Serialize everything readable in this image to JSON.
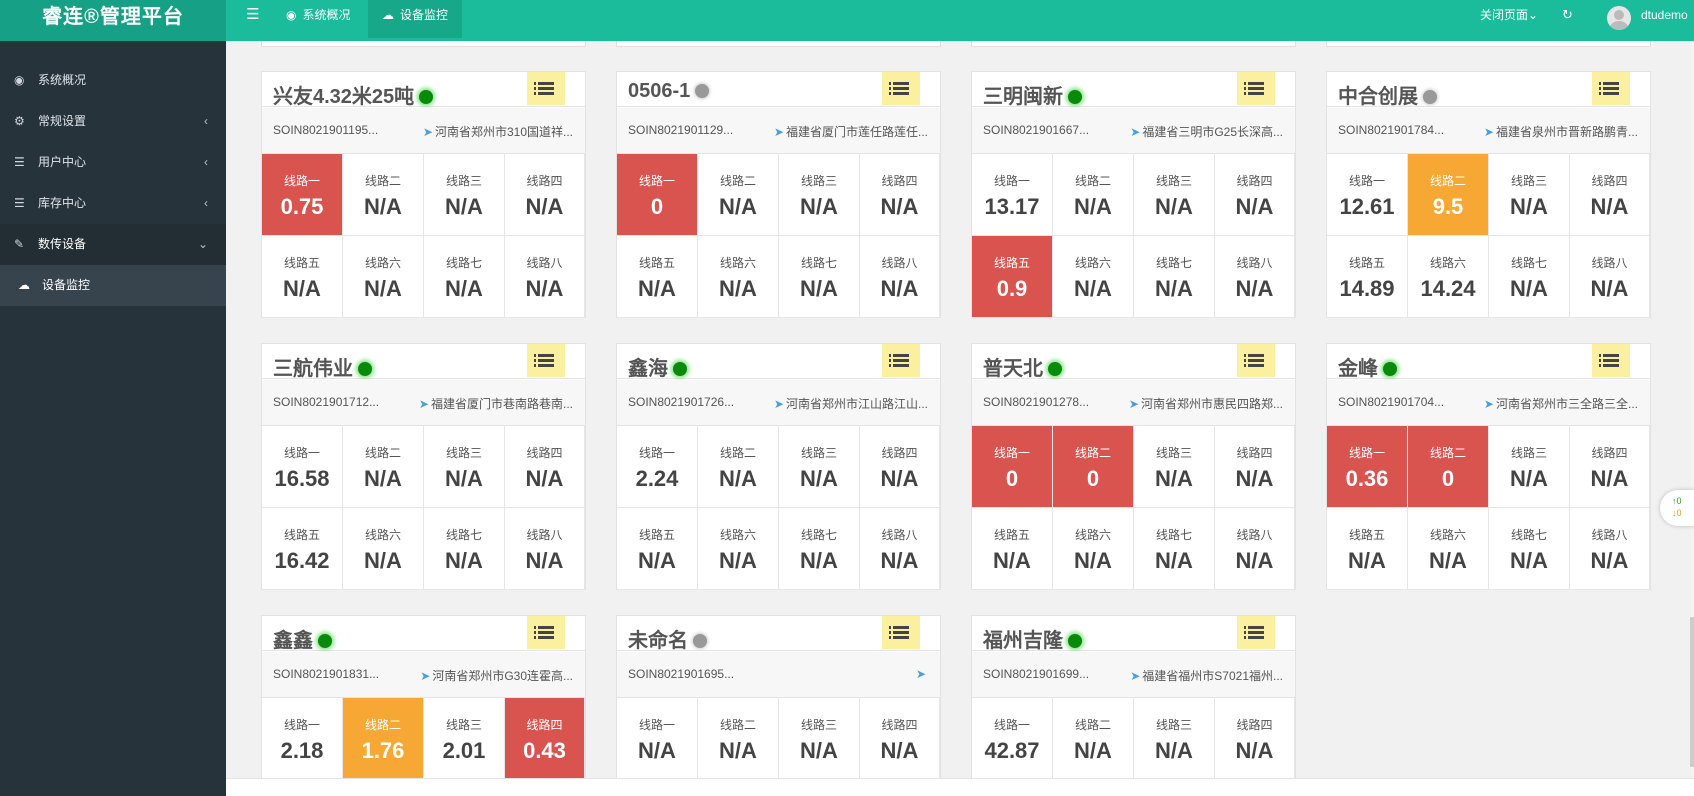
{
  "header": {
    "brand": "睿连®管理平台",
    "tabs": [
      {
        "label": "系统概况",
        "icon": "dashboard-icon"
      },
      {
        "label": "设备监控",
        "icon": "cloud-upload-icon"
      }
    ],
    "close_pages": "关闭页面",
    "username": "dtudemo"
  },
  "sidebar": {
    "items": [
      {
        "label": "系统概况",
        "icon": "dashboard-icon"
      },
      {
        "label": "常规设置",
        "icon": "cogs-icon"
      },
      {
        "label": "用户中心",
        "icon": "list-icon"
      },
      {
        "label": "库存中心",
        "icon": "list-icon"
      },
      {
        "label": "数传设备",
        "icon": "eraser-icon"
      }
    ],
    "sub_items": [
      {
        "label": "设备监控",
        "icon": "cloud-upload-icon"
      }
    ]
  },
  "line_labels": [
    "线路一",
    "线路二",
    "线路三",
    "线路四",
    "线路五",
    "线路六",
    "线路七",
    "线路八"
  ],
  "status_colors": {
    "alarm": "#d9534f",
    "warning": "#f7a834",
    "online": "#0a8a0a",
    "offline": "#999999"
  },
  "cards": [
    {
      "title": "兴友4.32米25吨",
      "online": true,
      "id": "SOIN8021901195...",
      "address": "河南省郑州市310国道祥...",
      "values": [
        "0.75",
        "N/A",
        "N/A",
        "N/A",
        "N/A",
        "N/A",
        "N/A",
        "N/A"
      ],
      "states": [
        "red",
        "",
        "",
        "",
        "",
        "",
        "",
        ""
      ]
    },
    {
      "title": "0506-1",
      "online": false,
      "id": "SOIN8021901129...",
      "address": "福建省厦门市莲任路莲任...",
      "values": [
        "0",
        "N/A",
        "N/A",
        "N/A",
        "N/A",
        "N/A",
        "N/A",
        "N/A"
      ],
      "states": [
        "red",
        "",
        "",
        "",
        "",
        "",
        "",
        ""
      ]
    },
    {
      "title": "三明闽新",
      "online": true,
      "id": "SOIN8021901667...",
      "address": "福建省三明市G25长深高...",
      "values": [
        "13.17",
        "N/A",
        "N/A",
        "N/A",
        "0.9",
        "N/A",
        "N/A",
        "N/A"
      ],
      "states": [
        "",
        "",
        "",
        "",
        "red",
        "",
        "",
        ""
      ]
    },
    {
      "title": "中合创展",
      "online": false,
      "id": "SOIN8021901784...",
      "address": "福建省泉州市晋新路鹏青...",
      "values": [
        "12.61",
        "9.5",
        "N/A",
        "N/A",
        "14.89",
        "14.24",
        "N/A",
        "N/A"
      ],
      "states": [
        "",
        "orange",
        "",
        "",
        "",
        "",
        "",
        ""
      ]
    },
    {
      "title": "三航伟业",
      "online": true,
      "id": "SOIN8021901712...",
      "address": "福建省厦门市巷南路巷南...",
      "values": [
        "16.58",
        "N/A",
        "N/A",
        "N/A",
        "16.42",
        "N/A",
        "N/A",
        "N/A"
      ],
      "states": [
        "",
        "",
        "",
        "",
        "",
        "",
        "",
        ""
      ]
    },
    {
      "title": "鑫海",
      "online": true,
      "id": "SOIN8021901726...",
      "address": "河南省郑州市江山路江山...",
      "values": [
        "2.24",
        "N/A",
        "N/A",
        "N/A",
        "N/A",
        "N/A",
        "N/A",
        "N/A"
      ],
      "states": [
        "",
        "",
        "",
        "",
        "",
        "",
        "",
        ""
      ]
    },
    {
      "title": "普天北",
      "online": true,
      "id": "SOIN8021901278...",
      "address": "河南省郑州市惠民四路郑...",
      "values": [
        "0",
        "0",
        "N/A",
        "N/A",
        "N/A",
        "N/A",
        "N/A",
        "N/A"
      ],
      "states": [
        "red",
        "red",
        "",
        "",
        "",
        "",
        "",
        ""
      ]
    },
    {
      "title": "金峰",
      "online": true,
      "id": "SOIN8021901704...",
      "address": "河南省郑州市三全路三全...",
      "values": [
        "0.36",
        "0",
        "N/A",
        "N/A",
        "N/A",
        "N/A",
        "N/A",
        "N/A"
      ],
      "states": [
        "red",
        "red",
        "",
        "",
        "",
        "",
        "",
        ""
      ]
    },
    {
      "title": "鑫鑫",
      "online": true,
      "id": "SOIN8021901831...",
      "address": "河南省郑州市G30连霍高...",
      "values": [
        "2.18",
        "1.76",
        "2.01",
        "0.43"
      ],
      "states": [
        "",
        "orange",
        "",
        "red"
      ]
    },
    {
      "title": "未命名",
      "online": false,
      "id": "SOIN8021901695...",
      "address": "",
      "values": [
        "N/A",
        "N/A",
        "N/A",
        "N/A"
      ],
      "states": [
        "",
        "",
        "",
        ""
      ]
    },
    {
      "title": "福州吉隆",
      "online": true,
      "id": "SOIN8021901699...",
      "address": "福建省福州市S7021福州...",
      "values": [
        "42.87",
        "N/A",
        "N/A",
        "N/A"
      ],
      "states": [
        "",
        "",
        "",
        ""
      ]
    }
  ],
  "net_monitor": {
    "up": "0",
    "down": "0"
  }
}
